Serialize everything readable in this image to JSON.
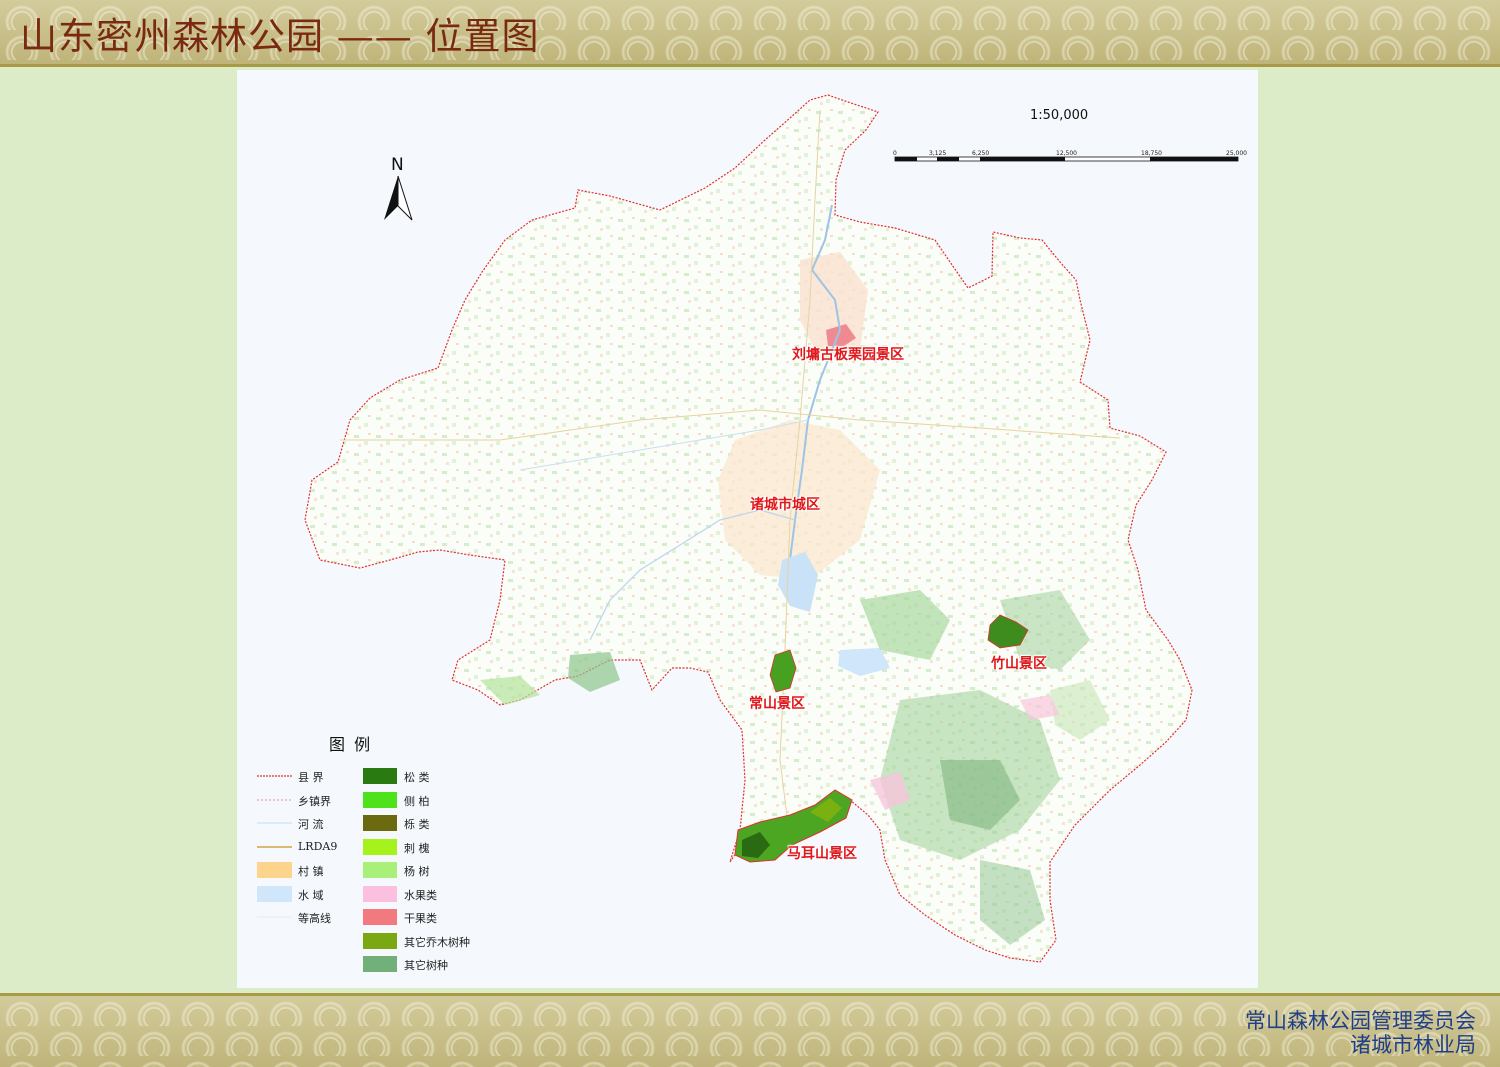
{
  "header": {
    "title": "山东密州森林公园 —— 位置图"
  },
  "footer": {
    "line1": "常山森林公园管理委员会",
    "line2": "诸城市林业局"
  },
  "map": {
    "scale_text": "1:50,000",
    "scale_ticks": [
      "0",
      "3,125",
      "6,250",
      "12,500",
      "18,750",
      "25,000"
    ],
    "north_label": "N",
    "places": [
      {
        "name": "刘墉古板栗园景区"
      },
      {
        "name": "诸城市城区"
      },
      {
        "name": "竹山景区"
      },
      {
        "name": "常山景区"
      },
      {
        "name": "马耳山景区"
      }
    ],
    "colors": {
      "boundary": "#e03030",
      "river": "#a8c8e8",
      "road": "#c8a040",
      "place_label": "#e0171b"
    }
  },
  "legend": {
    "title": "图 例",
    "left_items": [
      {
        "label": "县 界",
        "kind": "line",
        "color": "#e03030",
        "dash": "2,1"
      },
      {
        "label": "乡镇界",
        "kind": "line",
        "color": "#e8a0a8",
        "dash": "2,2"
      },
      {
        "label": "河 流",
        "kind": "line",
        "color": "#cfe0f0",
        "dash": "0"
      },
      {
        "label": "LRDA9",
        "kind": "line",
        "color": "#c8941e",
        "dash": "0"
      },
      {
        "label": "村 镇",
        "kind": "fill",
        "color": "#fcd48c"
      },
      {
        "label": "水 域",
        "kind": "fill",
        "color": "#cfe6fb"
      },
      {
        "label": "等高线",
        "kind": "line",
        "color": "#e8eef4",
        "dash": "0"
      }
    ],
    "right_items": [
      {
        "label": "松 类",
        "color": "#2a7a12"
      },
      {
        "label": "侧 柏",
        "color": "#4de21a"
      },
      {
        "label": "栎 类",
        "color": "#6b6a10"
      },
      {
        "label": "刺 槐",
        "color": "#a6f21c"
      },
      {
        "label": "杨 树",
        "color": "#a8f07a"
      },
      {
        "label": "水果类",
        "color": "#fbc0e0"
      },
      {
        "label": "干果类",
        "color": "#f27a7e"
      },
      {
        "label": "其它乔木树种",
        "color": "#7aa812"
      },
      {
        "label": "其它树种",
        "color": "#72b07a"
      }
    ]
  }
}
